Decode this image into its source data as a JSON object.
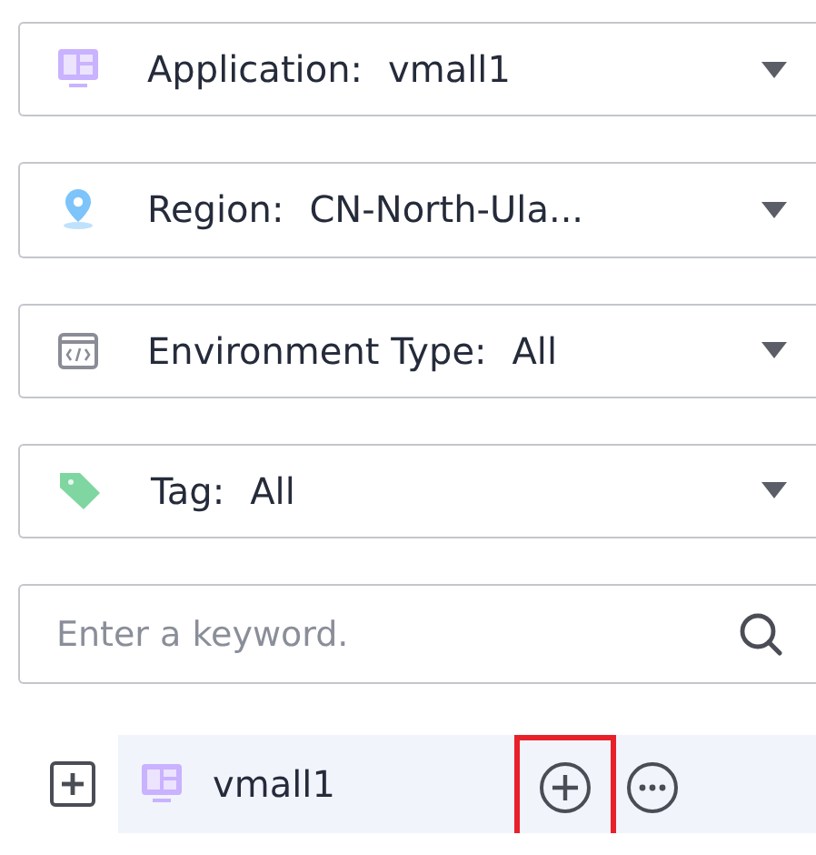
{
  "filters": [
    {
      "kind": "application",
      "label": "Application:",
      "value": "vmall1"
    },
    {
      "kind": "region",
      "label": "Region:",
      "value": "CN-North-Ula..."
    },
    {
      "kind": "environment",
      "label": "Environment Type:",
      "value": "All"
    },
    {
      "kind": "tag",
      "label": "Tag:",
      "value": "All"
    }
  ],
  "search": {
    "placeholder": "Enter a keyword."
  },
  "tree": [
    {
      "kind": "application",
      "label": "vmall1",
      "expanded": false,
      "selected": true,
      "actions": [
        {
          "kind": "add",
          "highlighted": true
        },
        {
          "kind": "more",
          "highlighted": false
        }
      ]
    }
  ]
}
